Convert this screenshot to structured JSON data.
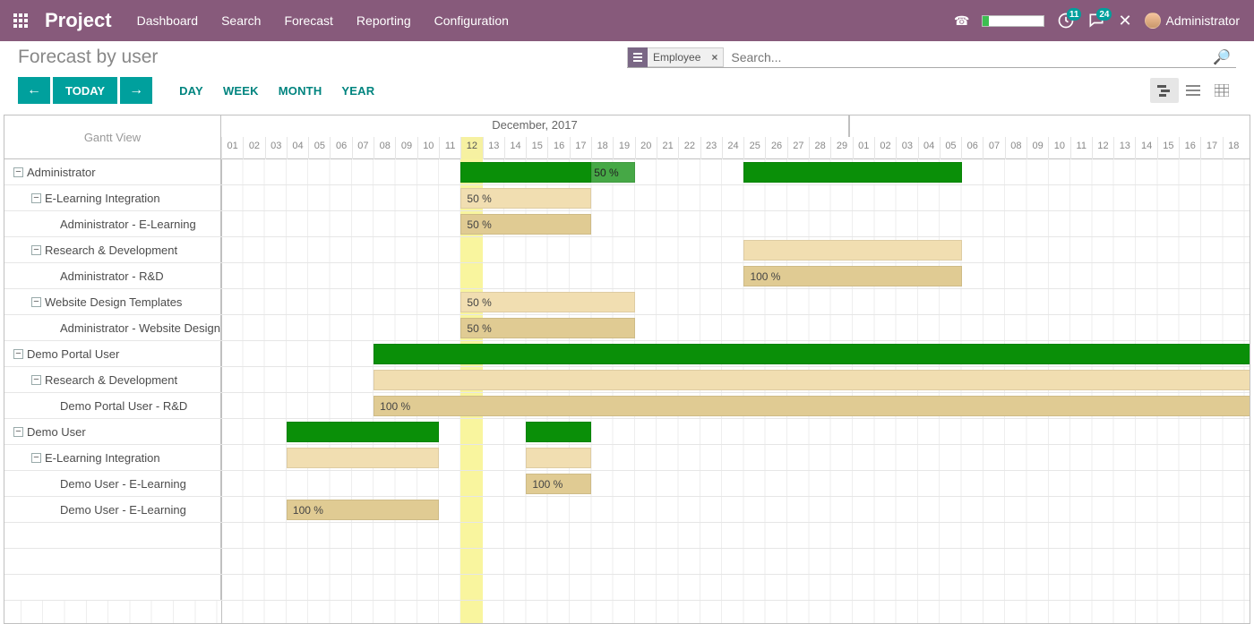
{
  "navbar": {
    "brand": "Project",
    "items": [
      "Dashboard",
      "Search",
      "Forecast",
      "Reporting",
      "Configuration"
    ],
    "badge1": "11",
    "badge2": "24",
    "user": "Administrator"
  },
  "control": {
    "title": "Forecast by user",
    "facet_label": "Employee",
    "search_placeholder": "Search...",
    "today": "TODAY",
    "scales": [
      "DAY",
      "WEEK",
      "MONTH",
      "YEAR"
    ]
  },
  "gantt": {
    "left_header": "Gantt View",
    "month": "December, 2017",
    "today_day": 12,
    "day_width": 24.31,
    "left_col_start": 242,
    "days": [
      "01",
      "02",
      "03",
      "04",
      "05",
      "06",
      "07",
      "08",
      "09",
      "10",
      "11",
      "12",
      "13",
      "14",
      "15",
      "16",
      "17",
      "18",
      "19",
      "20",
      "21",
      "22",
      "23",
      "24",
      "25",
      "26",
      "27",
      "28",
      "29",
      "01",
      "02",
      "03",
      "04",
      "05",
      "06",
      "07",
      "08",
      "09",
      "10",
      "11",
      "12",
      "13",
      "14",
      "15",
      "16",
      "17",
      "18"
    ],
    "rows": [
      {
        "level": 0,
        "exp": "-",
        "label": "Administrator",
        "bars": [
          {
            "start": 12,
            "span": 6,
            "cls": "green"
          },
          {
            "start": 18,
            "span": 2,
            "cls": "green2",
            "text": "50 %"
          },
          {
            "start": 25,
            "span": 10,
            "cls": "green"
          }
        ]
      },
      {
        "level": 1,
        "exp": "-",
        "label": "E-Learning Integration",
        "bars": [
          {
            "start": 12,
            "span": 6,
            "cls": "tan-lt",
            "text": "50 %"
          }
        ]
      },
      {
        "level": 2,
        "label": "Administrator - E-Learning",
        "bars": [
          {
            "start": 12,
            "span": 6,
            "cls": "tan-md",
            "text": "50 %"
          }
        ]
      },
      {
        "level": 1,
        "exp": "-",
        "label": "Research & Development",
        "bars": [
          {
            "start": 25,
            "span": 10,
            "cls": "tan-lt"
          }
        ]
      },
      {
        "level": 2,
        "label": "Administrator - R&D",
        "bars": [
          {
            "start": 25,
            "span": 10,
            "cls": "tan-md",
            "text": "100 %"
          }
        ]
      },
      {
        "level": 1,
        "exp": "-",
        "label": "Website Design Templates",
        "bars": [
          {
            "start": 12,
            "span": 8,
            "cls": "tan-lt",
            "text": "50 %"
          }
        ]
      },
      {
        "level": 2,
        "label": "Administrator - Website Design",
        "bars": [
          {
            "start": 12,
            "span": 8,
            "cls": "tan-md",
            "text": "50 %"
          }
        ]
      },
      {
        "level": 0,
        "exp": "-",
        "label": "Demo Portal User",
        "bars": [
          {
            "start": 8,
            "span": 42,
            "cls": "green"
          }
        ]
      },
      {
        "level": 1,
        "exp": "-",
        "label": "Research & Development",
        "bars": [
          {
            "start": 8,
            "span": 42,
            "cls": "tan-lt"
          }
        ]
      },
      {
        "level": 2,
        "label": "Demo Portal User - R&D",
        "bars": [
          {
            "start": 8,
            "span": 42,
            "cls": "tan-md",
            "text": "100 %"
          }
        ]
      },
      {
        "level": 0,
        "exp": "-",
        "label": "Demo User",
        "bars": [
          {
            "start": 4,
            "span": 7,
            "cls": "green"
          },
          {
            "start": 15,
            "span": 3,
            "cls": "green"
          }
        ]
      },
      {
        "level": 1,
        "exp": "-",
        "label": "E-Learning Integration",
        "bars": [
          {
            "start": 4,
            "span": 7,
            "cls": "tan-lt"
          },
          {
            "start": 15,
            "span": 3,
            "cls": "tan-lt"
          }
        ]
      },
      {
        "level": 2,
        "label": "Demo User - E-Learning",
        "bars": [
          {
            "start": 15,
            "span": 3,
            "cls": "tan-md",
            "text": "100 %"
          }
        ]
      },
      {
        "level": 2,
        "label": "Demo User - E-Learning",
        "bars": [
          {
            "start": 4,
            "span": 7,
            "cls": "tan-md",
            "text": "100 %"
          }
        ]
      },
      {
        "level": 0,
        "blank": true
      },
      {
        "level": 0,
        "blank": true
      },
      {
        "level": 0,
        "blank": true
      }
    ]
  },
  "chart_data": {
    "type": "gantt",
    "title": "Forecast by user — Gantt",
    "month": "December, 2017",
    "x_unit": "day-of-month (Dec 2017 → Jan 2018)",
    "today": 12,
    "series": [
      {
        "group": "Administrator",
        "task": "(summary)",
        "bars": [
          {
            "from": 12,
            "to": 17,
            "pct": 100
          },
          {
            "from": 18,
            "to": 19,
            "pct": 50
          },
          {
            "from": 25,
            "to": 34,
            "pct": 100
          }
        ]
      },
      {
        "group": "Administrator",
        "task": "E-Learning Integration",
        "pct": 50,
        "from": 12,
        "to": 17
      },
      {
        "group": "Administrator",
        "task": "Administrator - E-Learning",
        "pct": 50,
        "from": 12,
        "to": 17
      },
      {
        "group": "Administrator",
        "task": "Research & Development",
        "pct": 100,
        "from": 25,
        "to": 34
      },
      {
        "group": "Administrator",
        "task": "Administrator - R&D",
        "pct": 100,
        "from": 25,
        "to": 34
      },
      {
        "group": "Administrator",
        "task": "Website Design Templates",
        "pct": 50,
        "from": 12,
        "to": 19
      },
      {
        "group": "Administrator",
        "task": "Administrator - Website Design",
        "pct": 50,
        "from": 12,
        "to": 19
      },
      {
        "group": "Demo Portal User",
        "task": "(summary)",
        "pct": 100,
        "from": 8,
        "to_open": true
      },
      {
        "group": "Demo Portal User",
        "task": "Research & Development",
        "pct": 100,
        "from": 8,
        "to_open": true
      },
      {
        "group": "Demo Portal User",
        "task": "Demo Portal User - R&D",
        "pct": 100,
        "from": 8,
        "to_open": true
      },
      {
        "group": "Demo User",
        "task": "(summary)",
        "bars": [
          {
            "from": 4,
            "to": 10,
            "pct": 100
          },
          {
            "from": 15,
            "to": 17,
            "pct": 100
          }
        ]
      },
      {
        "group": "Demo User",
        "task": "E-Learning Integration",
        "bars": [
          {
            "from": 4,
            "to": 10,
            "pct": 100
          },
          {
            "from": 15,
            "to": 17,
            "pct": 100
          }
        ]
      },
      {
        "group": "Demo User",
        "task": "Demo User - E-Learning",
        "pct": 100,
        "from": 15,
        "to": 17
      },
      {
        "group": "Demo User",
        "task": "Demo User - E-Learning",
        "pct": 100,
        "from": 4,
        "to": 10
      }
    ]
  }
}
